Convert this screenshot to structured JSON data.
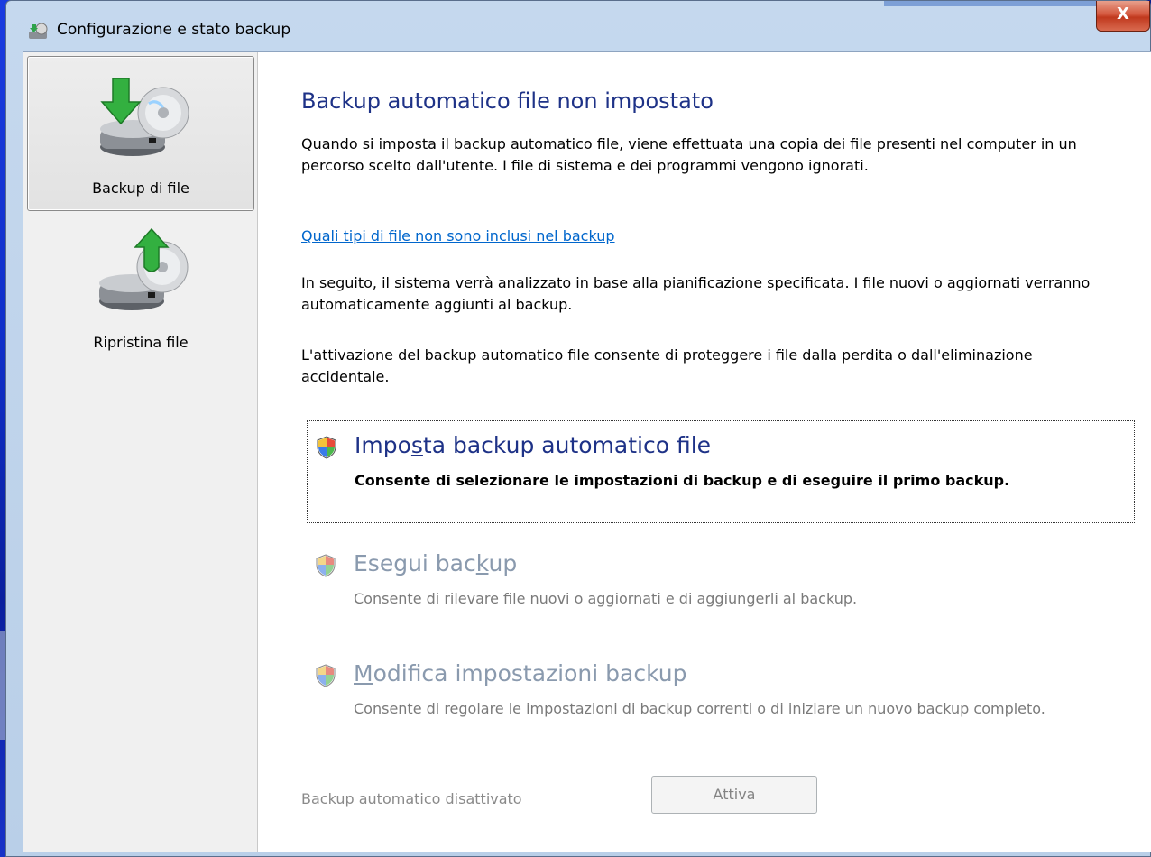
{
  "window": {
    "title": "Configurazione e stato backup",
    "close_label": "X"
  },
  "sidebar": {
    "items": [
      {
        "label": "Backup di file",
        "icon": "backup-drive-icon",
        "selected": true
      },
      {
        "label": "Ripristina file",
        "icon": "restore-drive-icon",
        "selected": false
      }
    ]
  },
  "main": {
    "heading": "Backup automatico file non impostato",
    "intro": "Quando si imposta il backup automatico file, viene effettuata una copia dei file presenti nel computer in un percorso scelto dall'utente. I file di sistema e dei programmi vengono ignorati.",
    "link": "Quali tipi di file non sono inclusi nel backup",
    "para2": "In seguito, il sistema verrà analizzato in base alla pianificazione specificata. I file nuovi o aggiornati verranno automaticamente aggiunti al backup.",
    "para3": "L'attivazione del backup automatico file consente di proteggere i file dalla perdita o dall'eliminazione accidentale.",
    "tasks": [
      {
        "title_pre": "Impo",
        "title_key": "s",
        "title_post": "ta backup automatico file",
        "desc": "Consente di selezionare le impostazioni di backup e di eseguire il primo backup.",
        "state": "active"
      },
      {
        "title_pre": "Esegui bac",
        "title_key": "k",
        "title_post": "up",
        "desc": "Consente di rilevare file nuovi o aggiornati e di aggiungerli al backup.",
        "state": "disabled"
      },
      {
        "title_pre": "",
        "title_key": "M",
        "title_post": "odifica impostazioni backup",
        "desc": "Consente di regolare le impostazioni di backup correnti o di iniziare un nuovo backup completo.",
        "state": "disabled"
      }
    ],
    "status_label": "Backup automatico disattivato",
    "activate_button": "Attiva"
  },
  "colors": {
    "heading": "#1e3287",
    "link": "#0066cc",
    "disabled_text": "#7a7a7a",
    "close_button": "#c0391e"
  }
}
